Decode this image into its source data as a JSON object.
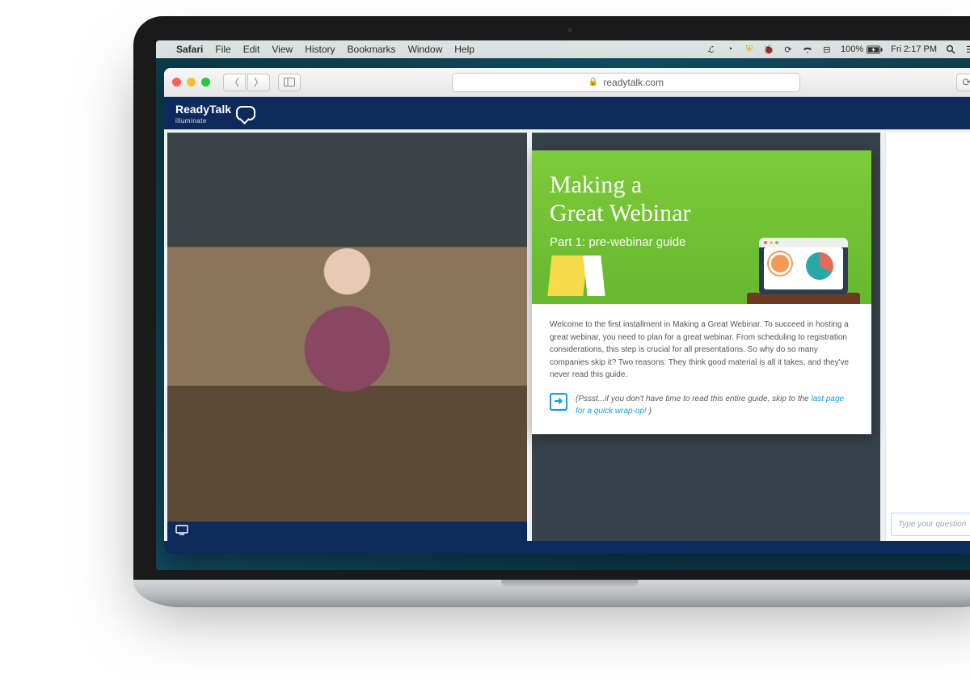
{
  "menubar": {
    "app": "Safari",
    "items": [
      "File",
      "Edit",
      "View",
      "History",
      "Bookmarks",
      "Window",
      "Help"
    ],
    "battery_pct": "100%",
    "clock": "Fri 2:17 PM"
  },
  "safari": {
    "address": "readytalk.com"
  },
  "app": {
    "brand": "ReadyTalk",
    "brand_sub": "illuminate"
  },
  "doc": {
    "title_line1": "Making a",
    "title_line2": "Great Webinar",
    "subtitle": "Part 1: pre-webinar guide",
    "intro": "Welcome to the first installment in Making a Great Webinar. To succeed in hosting a great webinar, you need to plan for a great webinar. From scheduling to registration considerations, this step is crucial for all presentations. So why do so many companies skip it? Two reasons: They think good material is all it takes, and they've never read this guide.",
    "tip_prefix": "(Pssst...if you don't have time to read this entire guide, skip to the ",
    "tip_link": "last page for a quick wrap-up!",
    "tip_suffix": ")"
  },
  "sidebar": {
    "question_placeholder": "Type your question"
  }
}
